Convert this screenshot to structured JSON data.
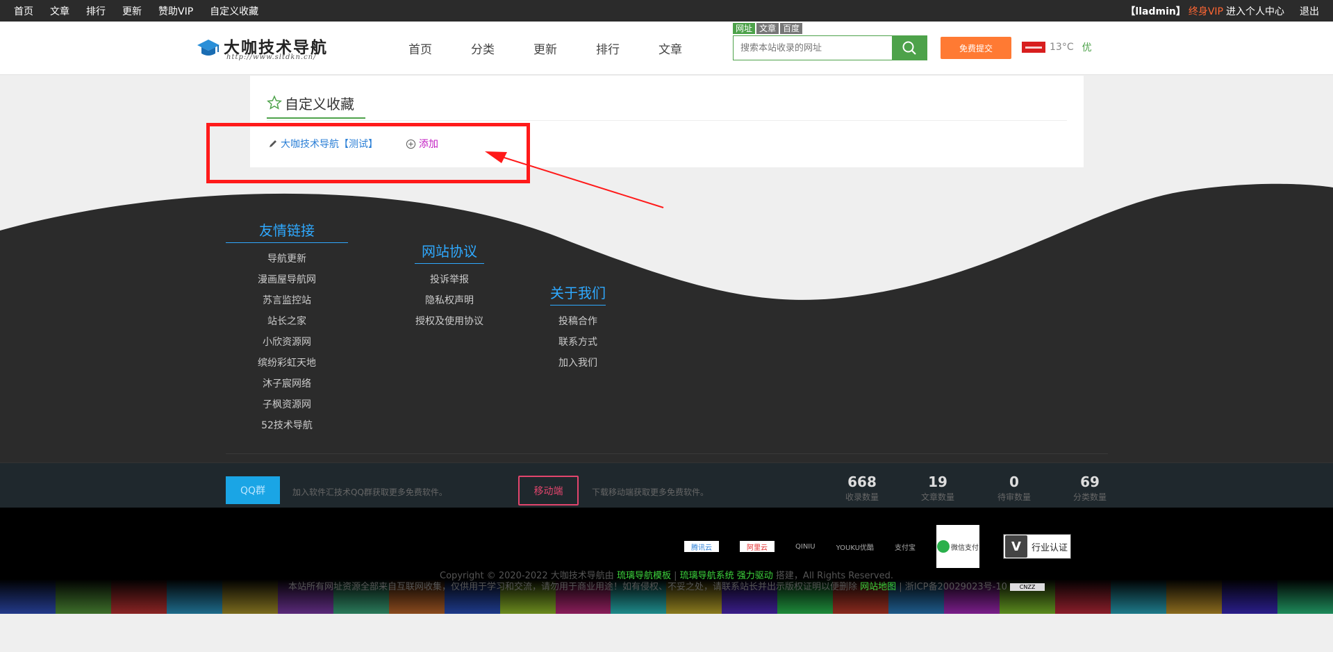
{
  "topbar": {
    "links": [
      "首页",
      "文章",
      "排行",
      "更新",
      "赞助VIP",
      "自定义收藏"
    ],
    "user": "【lladmin】",
    "vip": "终身VIP",
    "center": "进入个人中心",
    "logout": "退出"
  },
  "header": {
    "logo_name": "大咖技术导航",
    "logo_url": "http://www.sltdkn.cn/",
    "nav": [
      "首页",
      "分类",
      "更新",
      "排行",
      "文章"
    ],
    "search_tabs": [
      "网址",
      "文章",
      "百度"
    ],
    "search_placeholder": "搜索本站收录的网址",
    "submit_label": "免费提交",
    "temperature": "13°C",
    "air_quality": "优"
  },
  "favorites": {
    "title": "自定义收藏",
    "item_label": "大咖技术导航【测试】",
    "add_label": "添加"
  },
  "footer": {
    "friends": {
      "title": "友情链接",
      "items": [
        "导航更新",
        "漫画屋导航网",
        "苏言监控站",
        "站长之家",
        "小欣资源网",
        "缤纷彩虹天地",
        "沐子宸网络",
        "子枫资源网",
        "52技术导航"
      ]
    },
    "agreement": {
      "title": "网站协议",
      "items": [
        "投诉举报",
        "隐私权声明",
        "授权及使用协议"
      ]
    },
    "about": {
      "title": "关于我们",
      "items": [
        "投稿合作",
        "联系方式",
        "加入我们"
      ]
    },
    "qq_label": "QQ群",
    "qq_text": "加入软件汇技术QQ群获取更多免费软件。",
    "mobile_label": "移动端",
    "mobile_text": "下载移动端获取更多免费软件。",
    "stats": [
      {
        "num": "668",
        "label": "收录数量"
      },
      {
        "num": "19",
        "label": "文章数量"
      },
      {
        "num": "0",
        "label": "待审数量"
      },
      {
        "num": "69",
        "label": "分类数量"
      }
    ],
    "partners": [
      "腾讯云",
      "阿里云",
      "QINIU",
      "YOUKU优酷",
      "支付宝"
    ],
    "wechat_label": "微信支付",
    "cert_label": "行业认证",
    "cert_badge": "V",
    "copyright_pre": "Copyright © 2020-2022 大咖技术导航由",
    "copyright_l1": "琉璃导航模板",
    "copyright_sep": "|",
    "copyright_l2": "琉璃导航系统 强力驱动",
    "copyright_post": "搭建，All Rights Reserved.",
    "disclaimer": "本站所有网址资源全部来自互联网收集，仅供用于学习和交流，请勿用于商业用途！如有侵权、不妥之处，请联系站长并出示版权证明以便删除",
    "sitemap": "网站地图",
    "icp": "| 浙ICP备20029023号-10",
    "cnzz": "CNZZ"
  },
  "colors": {
    "accent": "#4da24a",
    "submit": "#ff7a33",
    "annotation": "#ff1a1a",
    "footer_dark": "#2b2b2b",
    "link_blue": "#2fa9ff"
  }
}
